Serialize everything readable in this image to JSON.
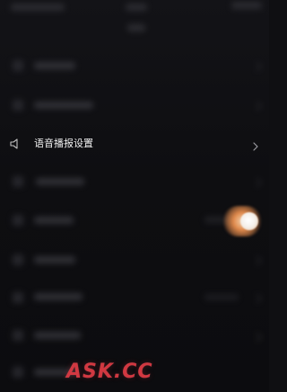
{
  "settings": {
    "voice_broadcast_label": "语音播报设置"
  },
  "watermark": {
    "text": "ASK.CC"
  },
  "colors": {
    "background": "#0f0f12",
    "accent_toggle": "#e0894b",
    "watermark": "#dc3741"
  },
  "icons": {
    "speaker": "speaker-icon",
    "chevron": "chevron-right-icon"
  }
}
